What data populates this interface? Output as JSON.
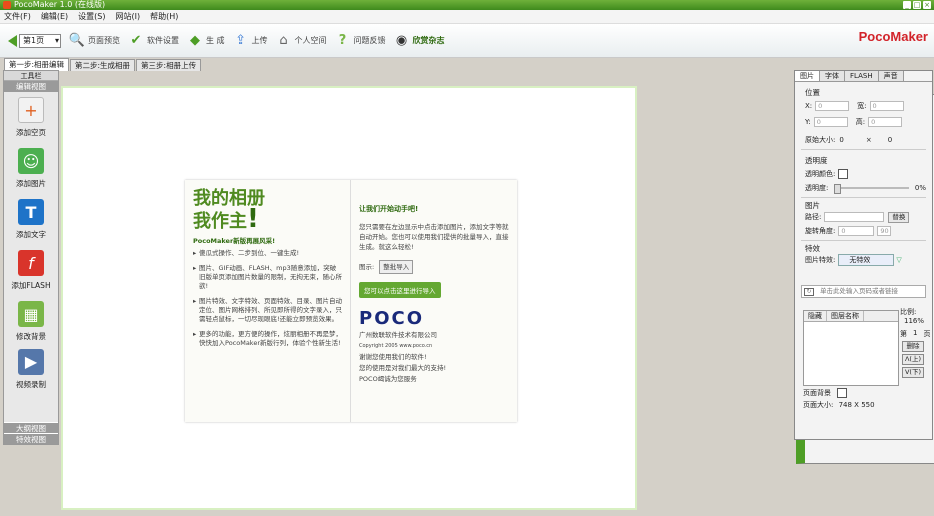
{
  "window": {
    "title": "PocoMaker 1.0 (在线版)"
  },
  "menu": [
    "文件(F)",
    "编辑(E)",
    "设置(S)",
    "网站(I)",
    "帮助(H)"
  ],
  "toolbar": {
    "page_select": "第1页",
    "items": [
      {
        "label": "页面预览",
        "icon": "magnifier-icon"
      },
      {
        "label": "软件设置",
        "icon": "gear-icon"
      },
      {
        "label": "生 成",
        "icon": "generate-icon"
      },
      {
        "label": "上传",
        "icon": "upload-icon"
      },
      {
        "label": "个人空间",
        "icon": "home-icon"
      },
      {
        "label": "问题反馈",
        "icon": "question-icon"
      },
      {
        "label": "欣赏杂志",
        "icon": "magazine-icon"
      }
    ],
    "logo": "PocoMaker"
  },
  "tabs": [
    "第一步:相册编辑",
    "第二步:生成相册",
    "第三步:相册上传"
  ],
  "left_panel": {
    "header": "工具栏",
    "section_edit": "编辑视图",
    "tools": [
      {
        "label": "添加空页",
        "icon": "add-page-icon",
        "color": "#f2f2f2"
      },
      {
        "label": "添加图片",
        "icon": "add-image-icon",
        "color": "#4caf50"
      },
      {
        "label": "添加文字",
        "icon": "add-text-icon",
        "color": "#1e73c8"
      },
      {
        "label": "添加FLASH",
        "icon": "add-flash-icon",
        "color": "#d9342b"
      },
      {
        "label": "修改背景",
        "icon": "background-icon",
        "color": "#7ab648"
      },
      {
        "label": "视频录制",
        "icon": "video-icon",
        "color": "#5577aa"
      }
    ],
    "section_outline": "大纲视图",
    "section_effects": "特效视图"
  },
  "canvas": {
    "left_page": {
      "title_line1": "我的相册",
      "title_line2": "我作主",
      "slogan": "PocoMaker新版再展风采!",
      "bullets": [
        "傻瓜式操作、二步到位、一键生成!",
        "图片、GIF动画、FLASH、mp3随意添加，突破旧版单页添加图片数量的限制，无拘无束，随心所欲!",
        "图片特效、文字特效、页面特效、目录、图片自动定位、图片网格排列、所见即所得的文字录入，只需轻点鼠标，一切尽现眼底!还能立即预览效果。",
        "更多的功能，更方便的操作，炫丽相册不再是梦，快快加入PocoMaker新版行列，体验个性新生活!"
      ]
    },
    "right_page": {
      "title": "让我们开始动手吧!",
      "text": "您只需要在左边显示中点击添加图片，添加文字等就自动开始。您也可以使用我们提供的批量导入，直接生成。就这么轻松!",
      "example_label": "图示:",
      "import_button": "整批导入",
      "bubble": "您可以点击这里进行导入",
      "logo_poco": "POCO",
      "company": "广州数联软件技术有限公司",
      "copyright": "Copyright 2005 www.poco.cn",
      "thanks1": "谢谢您使用我们的软件!",
      "thanks2": "您的使用是对我们最大的支持!",
      "thanks3": "POCO竭诚为您服务"
    }
  },
  "right_panel": {
    "tabs": [
      "图片",
      "字体",
      "FLASH",
      "声音"
    ],
    "position_label": "位置",
    "x_label": "X:",
    "x_value": "0",
    "y_label": "Y:",
    "y_value": "0",
    "width_label": "宽:",
    "width_value": "0",
    "height_label": "高:",
    "height_value": "0",
    "original_size_label": "原始大小:",
    "original_w": "0",
    "times": "×",
    "original_h": "0",
    "transparency_label": "透明度",
    "transparent_color_label": "透明颜色:",
    "opacity_label": "透明度:",
    "opacity_value": "0%",
    "image_label": "图片",
    "path_label": "路径:",
    "replace_button": "替换",
    "rotate_label": "旋转角度:",
    "rotate_value": "0",
    "rotate_right": "90",
    "effect_label": "特效",
    "image_effect_label": "图片特效:",
    "effect_value": "无特效",
    "link_placeholder": "单击此处输入页码或者链接",
    "layers_col1": "隐藏",
    "layers_col2": "图层名称",
    "zoom_label": "比例:",
    "zoom_value": "116%",
    "page_label": "第",
    "page_num": "1",
    "page_suffix": "页",
    "delete_button": "删除",
    "up_button": "Λ(上)",
    "down_button": "V(下)",
    "page_bg_label": "页面背景",
    "page_size_label": "页面大小:",
    "page_size_value": "748 X 550"
  }
}
